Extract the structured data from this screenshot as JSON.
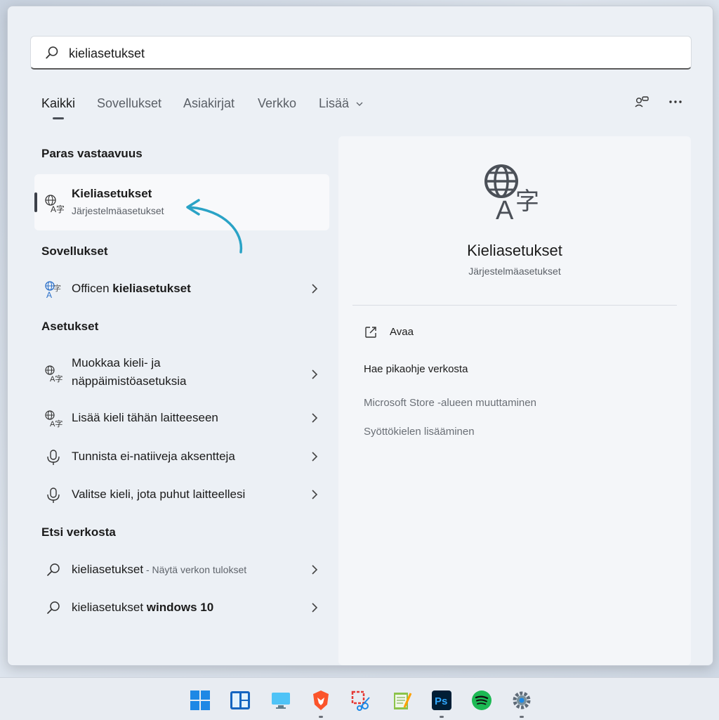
{
  "search": {
    "value": "kieliasetukset"
  },
  "tabs": [
    {
      "label": "Kaikki"
    },
    {
      "label": "Sovellukset"
    },
    {
      "label": "Asiakirjat"
    },
    {
      "label": "Verkko"
    },
    {
      "label": "Lisää"
    }
  ],
  "sections": {
    "best": "Paras vastaavuus",
    "apps": "Sovellukset",
    "settings": "Asetukset",
    "web": "Etsi verkosta"
  },
  "best_match": {
    "title": "Kieliasetukset",
    "subtitle": "Järjestelmäasetukset"
  },
  "apps": [
    {
      "prefix": "Officen ",
      "bold": "kieliasetukset"
    }
  ],
  "settings": [
    {
      "line1": "Muokkaa kieli- ja",
      "line2": "näppäimistöasetuksia"
    },
    {
      "label": "Lisää kieli tähän laitteeseen"
    },
    {
      "label": "Tunnista ei-natiiveja aksentteja"
    },
    {
      "label": "Valitse kieli, jota puhut laitteellesi"
    }
  ],
  "web": [
    {
      "label": "kieliasetukset",
      "suffix": " - Näytä verkon tulokset"
    },
    {
      "prefix": "kieliasetukset ",
      "bold": "windows 10"
    }
  ],
  "detail": {
    "title": "Kieliasetukset",
    "subtitle": "Järjestelmäasetukset",
    "open": "Avaa",
    "help_header": "Hae pikaohje verkosta",
    "links": [
      "Microsoft Store -alueen muuttaminen",
      "Syöttökielen lisääminen"
    ]
  },
  "colors": {
    "accent": "#2aa3c6",
    "text": "#1b1b1b",
    "muted": "#5a5f66"
  }
}
